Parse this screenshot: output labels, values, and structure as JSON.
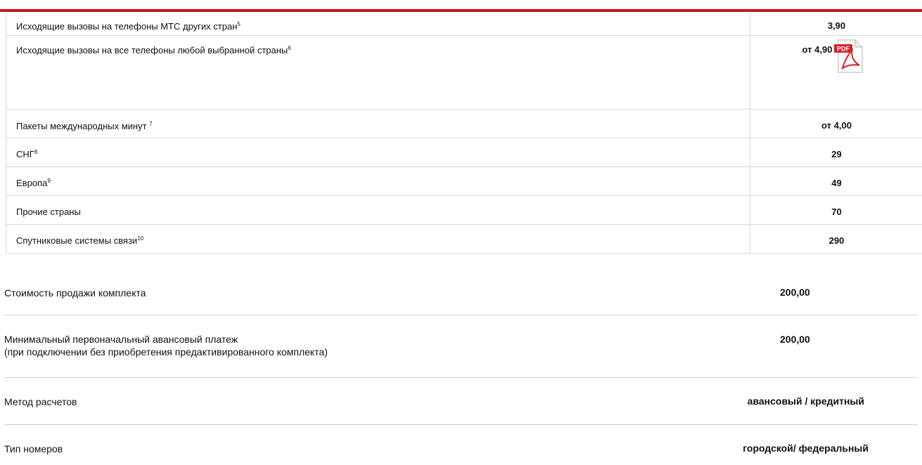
{
  "table": {
    "rows": [
      {
        "label": "Исходящие вызовы на телефоны МТС других стран",
        "sup": "5",
        "value": "3,90"
      },
      {
        "label": "Исходящие вызовы на все телефоны любой выбранной страны",
        "sup": "6",
        "value": "от 4,90"
      },
      {
        "label": "Пакеты международных минут ",
        "sup": "7",
        "value": "от 4,00"
      },
      {
        "label": "СНГ",
        "sup": "8",
        "value": "29"
      },
      {
        "label": "Европа",
        "sup": "9",
        "value": "49"
      },
      {
        "label": "Прочие страны",
        "sup": "",
        "value": "70"
      },
      {
        "label": "Спутниковые системы связи",
        "sup": "10",
        "value": "290"
      }
    ],
    "pdf_icon": "pdf-file-icon",
    "pdf_text": "PDF"
  },
  "summary": {
    "kit_price_label": "Стоимость продажи комплекта",
    "kit_price_value": "200,00",
    "advance_label_line1": "Минимальный первоначальный авансовый платеж",
    "advance_label_line2": "(при подключении без приобретения предактивированного комплекта)",
    "advance_value": "200,00",
    "payment_method_label": "Метод расчетов",
    "payment_method_value": "авансовый / кредитный",
    "number_type_label": "Тип номеров",
    "number_type_value": "городской/ федеральный"
  },
  "colors": {
    "accent": "#c4161c",
    "divider": "#d8d8d8"
  }
}
